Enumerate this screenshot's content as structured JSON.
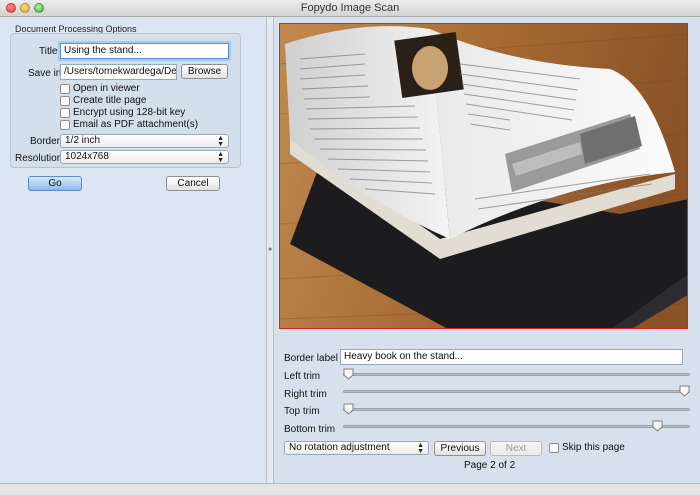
{
  "window": {
    "title": "Fopydo Image Scan"
  },
  "options": {
    "group_title": "Document Processing Options",
    "title_label": "Title",
    "title_value": "Using the stand...",
    "save_label": "Save in",
    "save_value": "/Users/tomekwardega/De",
    "browse_label": "Browse",
    "checkboxes": [
      {
        "label": "Open in viewer",
        "checked": false
      },
      {
        "label": "Create title page",
        "checked": false
      },
      {
        "label": "Encrypt using 128-bit key",
        "checked": false
      },
      {
        "label": "Email as PDF attachment(s)",
        "checked": false
      }
    ],
    "border_label": "Border",
    "border_value": "1/2 inch",
    "resolution_label": "Resolution",
    "resolution_value": "1024x768",
    "go_label": "Go",
    "cancel_label": "Cancel"
  },
  "editor": {
    "border_label_label": "Border label",
    "border_label_value": "Heavy book on the stand...",
    "trims": [
      {
        "label": "Left trim",
        "value": 0.0
      },
      {
        "label": "Right trim",
        "value": 1.0
      },
      {
        "label": "Top trim",
        "value": 0.0
      },
      {
        "label": "Bottom trim",
        "value": 0.92
      }
    ],
    "rotation_value": "No rotation adjustment",
    "previous_label": "Previous",
    "next_label": "Next",
    "skip_label": "Skip this page",
    "skip_checked": false,
    "page_indicator": "Page 2 of 2"
  },
  "colors": {
    "accent": "#5b8fd6",
    "image_border": "#e02121"
  }
}
